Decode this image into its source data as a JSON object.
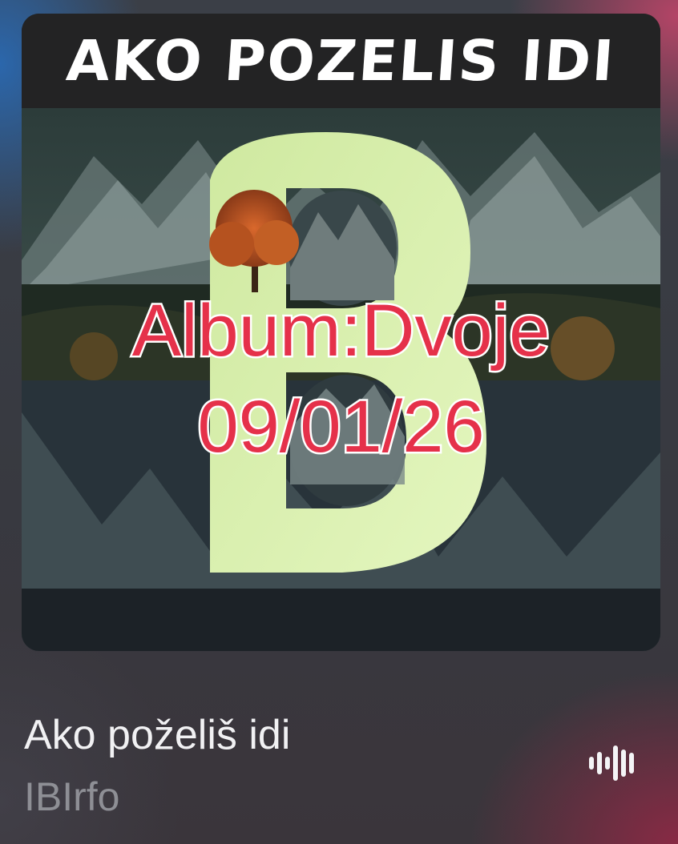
{
  "artwork": {
    "header_title": "AKO POZELIS IDI",
    "overlay_album": "Album:Dvoje",
    "overlay_date": "09/01/26",
    "overlay_color": "#e5314a",
    "letter_color": "#d8f0a8"
  },
  "now_playing": {
    "title": "Ako poželiš idi",
    "artist": "IBIrfo",
    "playing_indicator_icon": "waveform-icon"
  }
}
